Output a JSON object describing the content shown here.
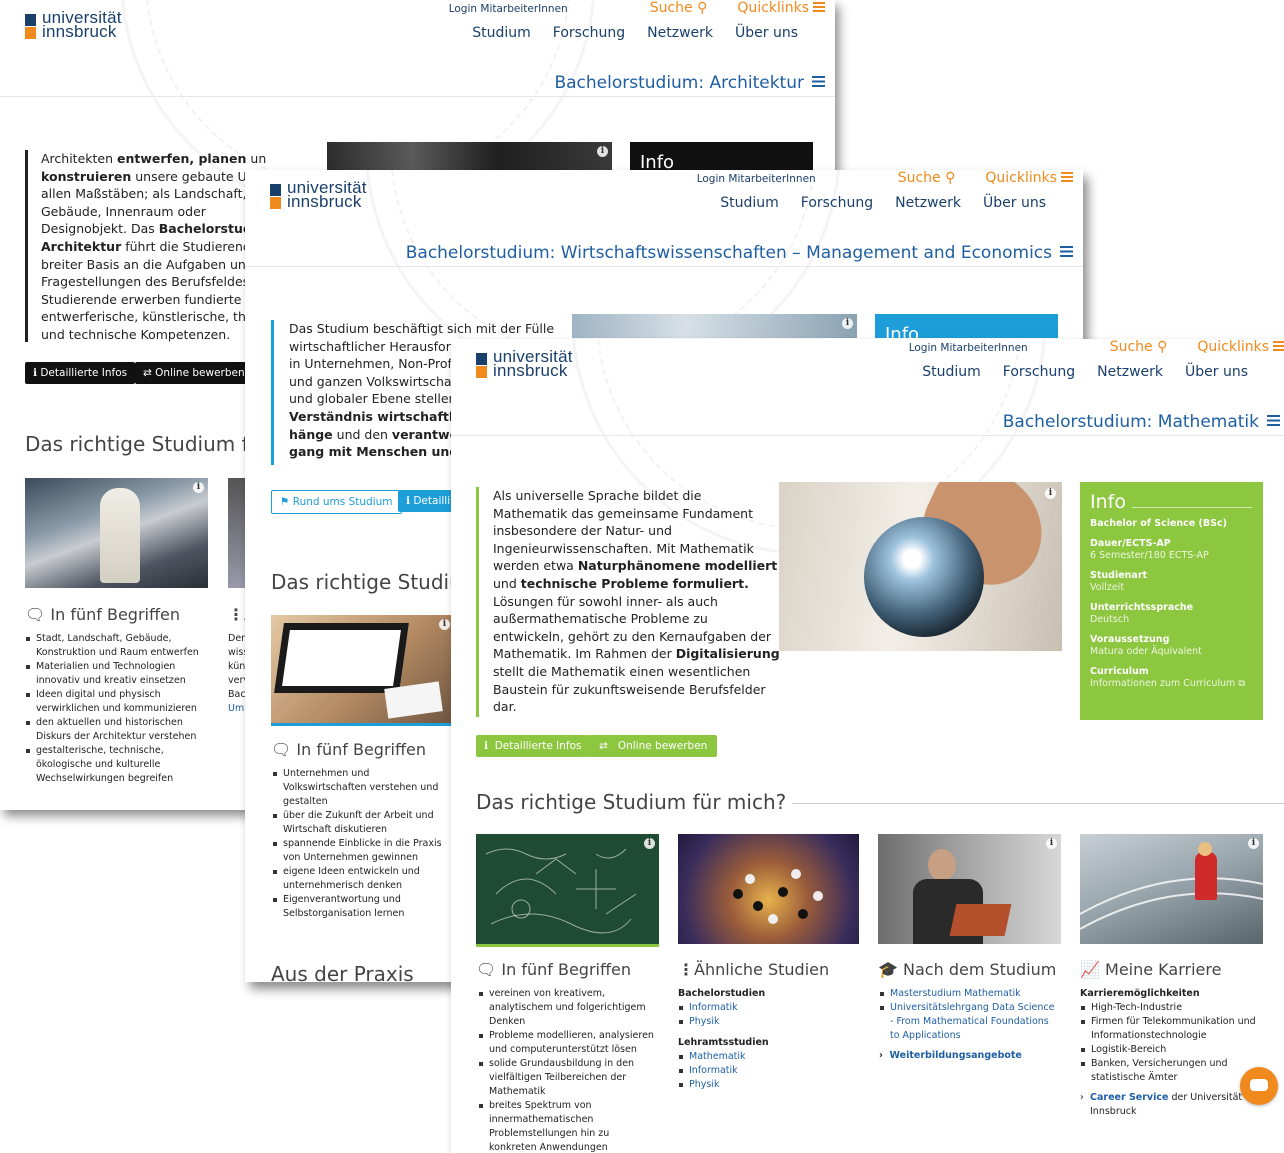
{
  "brand": {
    "line1": "universität",
    "line2": "innsbruck"
  },
  "util": {
    "login": "Login MitarbeiterInnen",
    "search": "Suche",
    "quicklinks": "Quicklinks"
  },
  "nav": [
    "Studium",
    "Forschung",
    "Netzwerk",
    "Über uns"
  ],
  "colors": {
    "navy": "#1a3f6b",
    "orange": "#f08a1c",
    "blue": "#1e5fa3",
    "green": "#8dc63f",
    "infobox_blue": "#1d9ed9"
  },
  "w1": {
    "title": "Bachelorstudium: Architektur",
    "intro": [
      "Architekten ",
      "entwerfen, planen",
      " und ",
      "konstruieren",
      " unsere gebaute Umw",
      "allen Maßstäben; als Landschaft, Sta",
      "Gebäude, Innenraum oder",
      "Designobjekt. Das ",
      "Bachelorstudium",
      "Architektur",
      " führt die Studierenden",
      "breiter Basis an die Aufgaben und",
      "Fragestellungen des Berufsfeldes he",
      "Studierende erwerben fundierte",
      "entwerferische, künstlerische, theor",
      "und technische Kompetenzen."
    ],
    "btn1": "Detaillierte Infos",
    "btn2": "Online bewerben",
    "h2": "Das richtige Studium für",
    "info": "Info",
    "col1": "In fünf Begriffen",
    "col2": "Ä",
    "list1": [
      "Stadt, Landschaft, Gebäude, Konstruktion und Raum entwerfen",
      "Materialien und Technologien innovativ und kreativ einsetzen",
      "Ideen digital und physisch verwirklichen und kommunizieren",
      "den aktuellen und historischen Diskurs der Architektur verstehen",
      "gestalterische, technische, ökologische und kulturelle Wechselwirkungen begreifen"
    ],
    "col2text": [
      "Der",
      "wiss",
      "küns",
      "verv",
      "Bac",
      "Umv"
    ]
  },
  "w2": {
    "title": "Bachelorstudium: Wirtschaftswissenschaften – Management and Economics",
    "intro": [
      "Das Studium beschäftigt sich mit der Fülle",
      "wirtschaftlicher Herausforde",
      "in Unternehmen, Non-Profit-",
      "und ganzen Volkswirtschafte",
      "und globaler Ebene stellen. E",
      "Verständnis wirtschaftlicher",
      "hänge",
      " und den ",
      "verantwortu",
      "gang mit Menschen und Res"
    ],
    "btn1": "Rund ums Studium",
    "btn2": "Detailli",
    "h2": "Das richtige Studiun",
    "info": "Info",
    "col1": "In fünf Begriffen",
    "list1": [
      "Unternehmen und Volkswirtschaften verstehen und gestalten",
      "über die Zukunft der Arbeit und Wirtschaft diskutieren",
      "spannende Einblicke in die Praxis von Unternehmen gewinnen",
      "eigene Ideen entwickeln und unternehmerisch denken",
      "Eigenverantwortung und Selbstorganisation lernen"
    ],
    "h2b": "Aus der Praxis"
  },
  "w3": {
    "title": "Bachelorstudium: Mathematik",
    "intro": [
      "Als universelle Sprache bildet die",
      "Mathematik das gemeinsame Fundament",
      "insbesondere der Natur- und",
      "Ingenieurwissenschaften. Mit Mathematik",
      "werden etwa ",
      "Naturphänomene modelliert",
      "und ",
      "technische Probleme formuliert.",
      "Lösungen für sowohl inner- als auch",
      "außermathematische Probleme zu",
      "entwickeln, gehört zu den Kernaufgaben der",
      "Mathematik. Im Rahmen der ",
      "Digitalisierung",
      "stellt die Mathematik einen wesentlichen",
      "Baustein für zukunftsweisende Berufsfelder",
      "dar."
    ],
    "btn1": "Detaillierte Infos",
    "btn2": "Online bewerben",
    "h2": "Das richtige Studium für mich?",
    "info": {
      "heading": "Info",
      "degree": "Bachelor of Science (BSc)",
      "rows": [
        {
          "l": "Dauer/ECTS-AP",
          "v": "6 Semester/180 ECTS-AP"
        },
        {
          "l": "Studienart",
          "v": "Vollzeit"
        },
        {
          "l": "Unterrichtssprache",
          "v": "Deutsch"
        },
        {
          "l": "Voraussetzung",
          "v": "Matura oder Äquivalent"
        },
        {
          "l": "Curriculum",
          "v": "Informationen zum Curriculum"
        }
      ]
    },
    "cols": {
      "c1": {
        "title": "In fünf Begriffen",
        "items": [
          "vereinen von kreativem, analytischem und folgerichtigem Denken",
          "Probleme modellieren, analysieren und computerunterstützt lösen",
          "solide Grundausbildung in den vielfältigen Teilbereichen der Mathematik",
          "breites Spektrum von innermathematischen Problemstellungen hin zu konkreten Anwendungen"
        ]
      },
      "c2": {
        "title": "Ähnliche Studien",
        "sub1": "Bachelorstudien",
        "l1": [
          "Informatik",
          "Physik"
        ],
        "sub2": "Lehramtsstudien",
        "l2": [
          "Mathematik",
          "Informatik",
          "Physik"
        ]
      },
      "c3": {
        "title": "Nach dem Studium",
        "items": [
          "Masterstudium Mathematik",
          "Universitätslehrgang Data Science - From Mathematical Foundations to Applications"
        ],
        "more": "Weiterbildungsangebote"
      },
      "c4": {
        "title": "Meine Karriere",
        "sub": "Karrieremöglichkeiten",
        "items": [
          "High-Tech-Industrie",
          "Firmen für Telekommunikation und Informationstechnologie",
          "Logistik-Bereich",
          "Banken, Versicherungen und statistische Ämter"
        ],
        "cs_link": "Career Service",
        "cs_rest": "der Universität Innsbruck"
      }
    }
  }
}
